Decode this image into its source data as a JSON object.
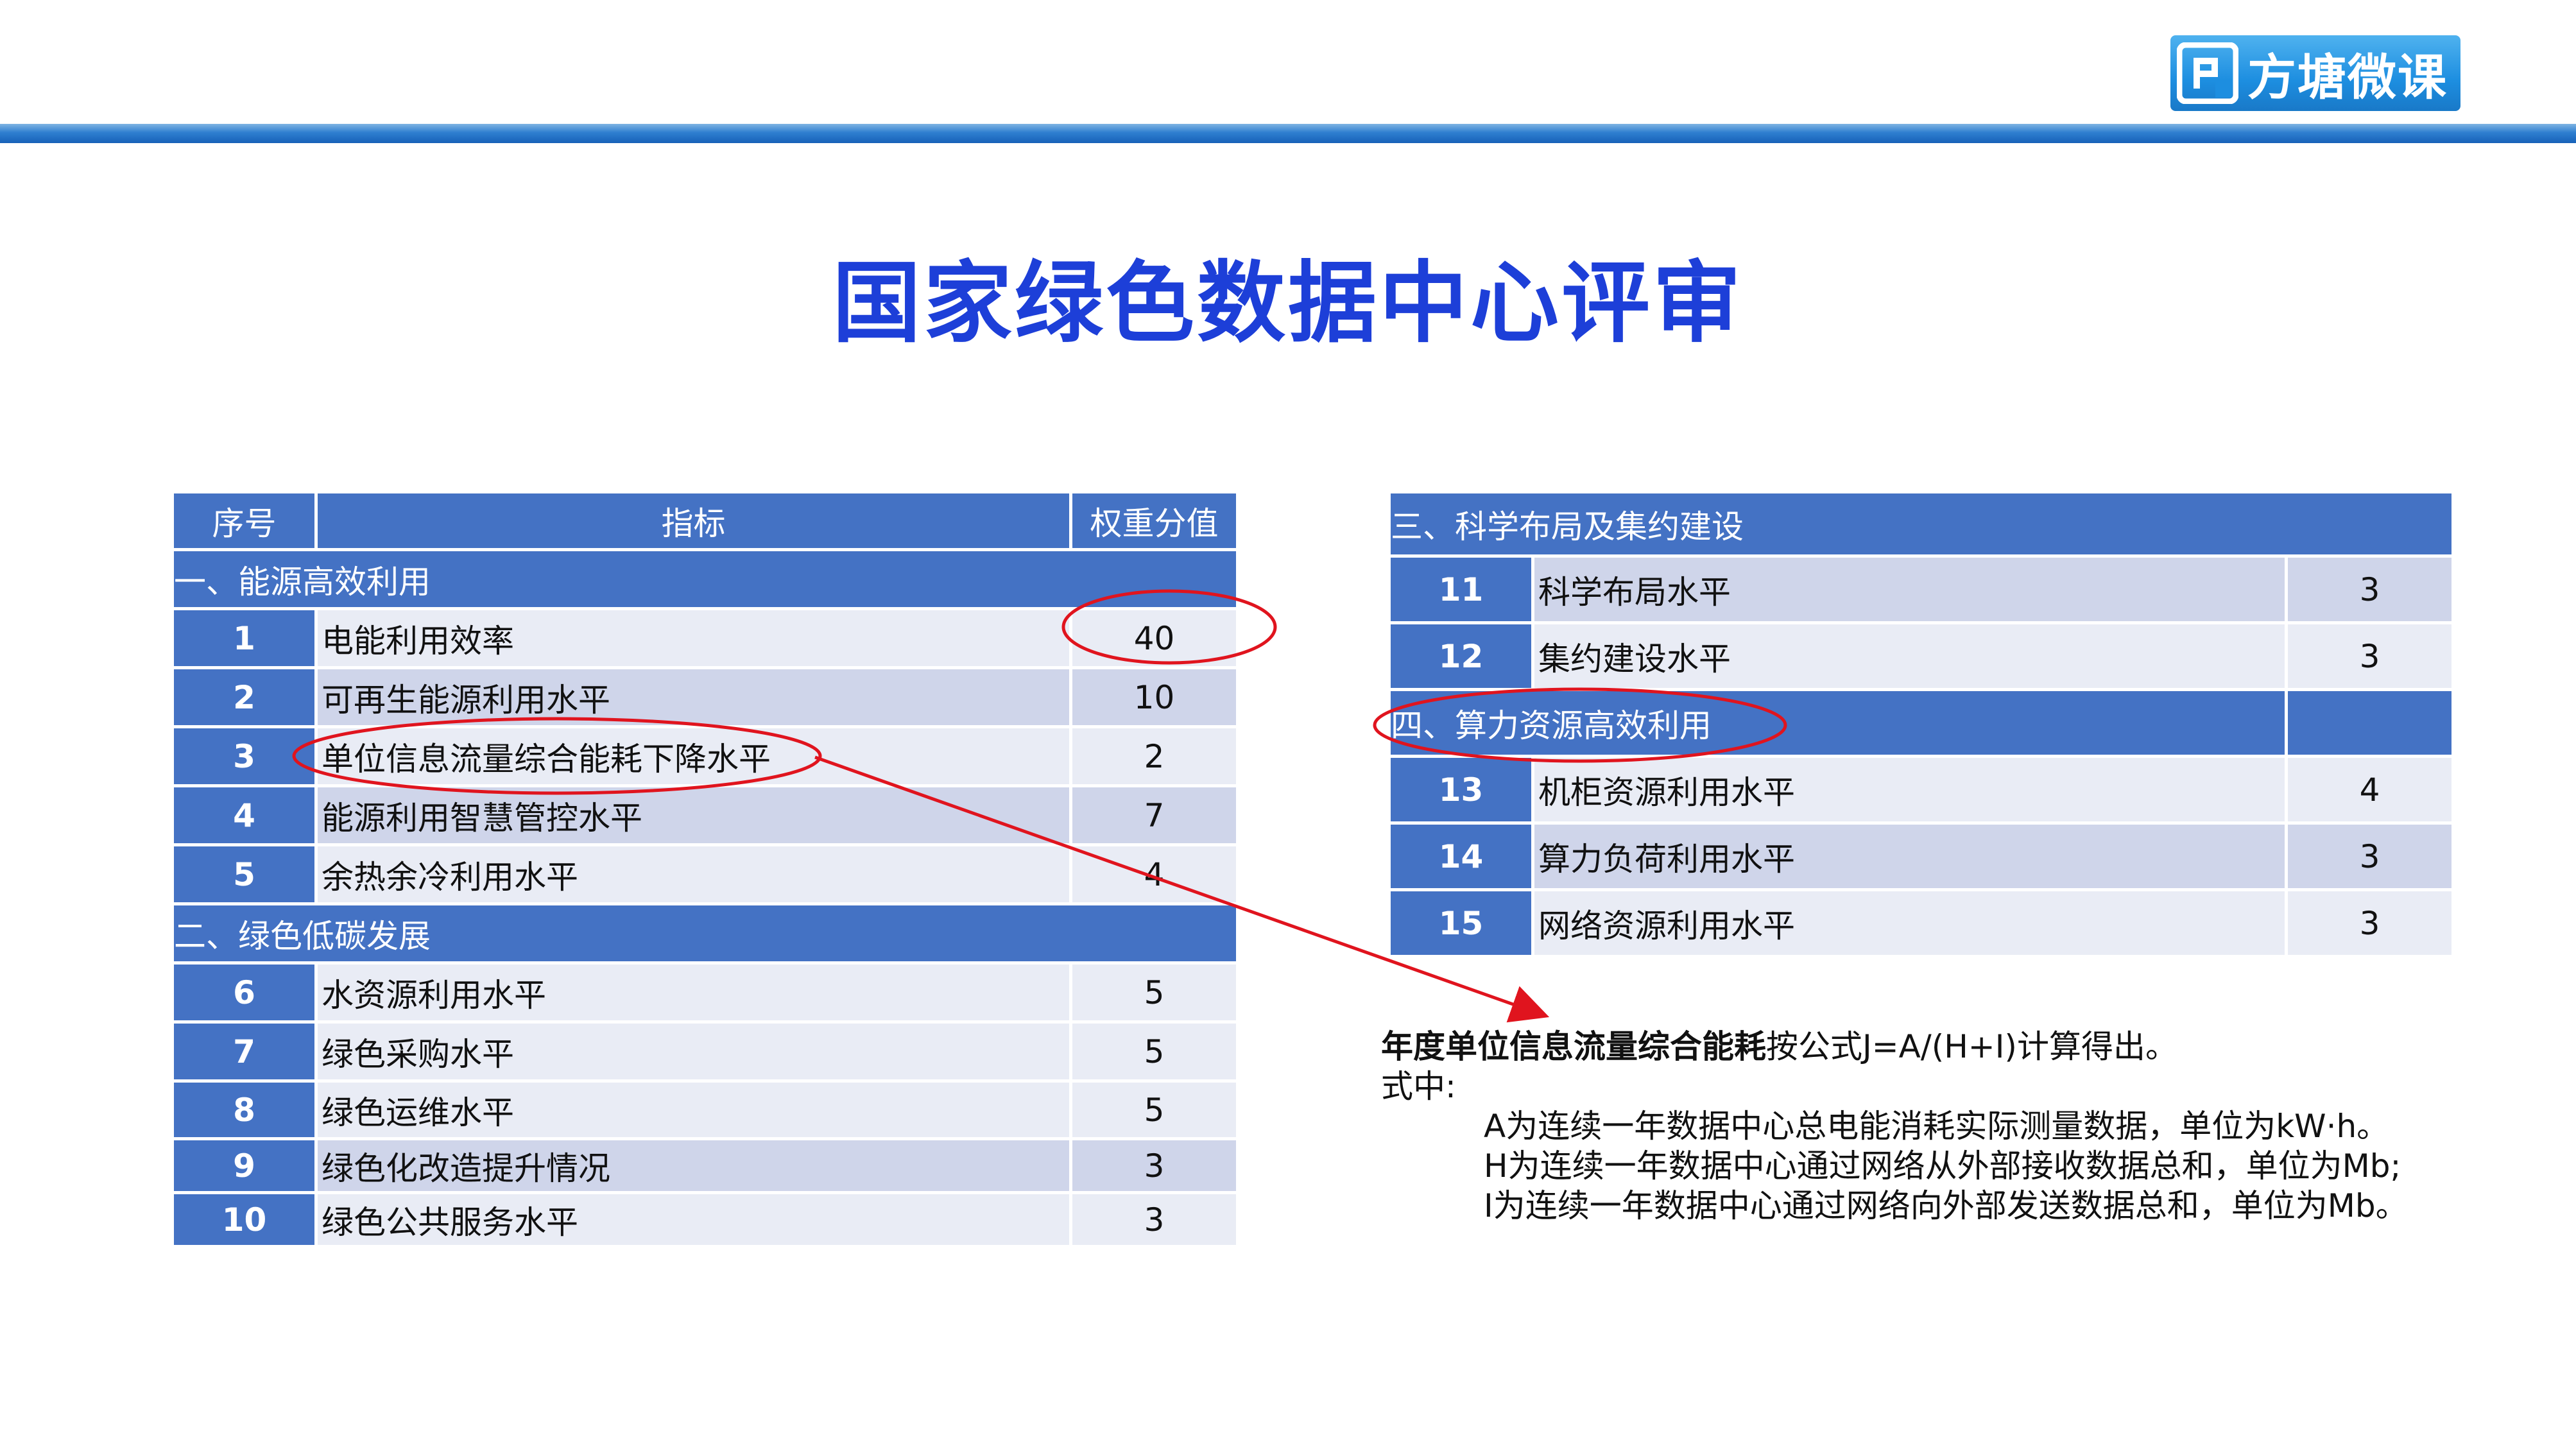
{
  "logo": {
    "text": "方塘微课"
  },
  "title": "国家绿色数据中心评审",
  "left_table": {
    "headers": {
      "no": "序号",
      "indicator": "指标",
      "weight": "权重分值"
    },
    "sections": [
      {
        "title": "一、能源高效利用",
        "rows": [
          {
            "no": "1",
            "indicator": "电能利用效率",
            "weight": "40"
          },
          {
            "no": "2",
            "indicator": "可再生能源利用水平",
            "weight": "10"
          },
          {
            "no": "3",
            "indicator": "单位信息流量综合能耗下降水平",
            "weight": "2"
          },
          {
            "no": "4",
            "indicator": "能源利用智慧管控水平",
            "weight": "7"
          },
          {
            "no": "5",
            "indicator": "余热余冷利用水平",
            "weight": "4"
          }
        ]
      },
      {
        "title": "二、绿色低碳发展",
        "rows": [
          {
            "no": "6",
            "indicator": "水资源利用水平",
            "weight": "5"
          },
          {
            "no": "7",
            "indicator": "绿色采购水平",
            "weight": "5"
          },
          {
            "no": "8",
            "indicator": "绿色运维水平",
            "weight": "5"
          },
          {
            "no": "9",
            "indicator": "绿色化改造提升情况",
            "weight": "3"
          },
          {
            "no": "10",
            "indicator": "绿色公共服务水平",
            "weight": "3"
          }
        ]
      }
    ]
  },
  "right_table": {
    "sections": [
      {
        "title": "三、科学布局及集约建设",
        "rows": [
          {
            "no": "11",
            "indicator": "科学布局水平",
            "weight": "3"
          },
          {
            "no": "12",
            "indicator": "集约建设水平",
            "weight": "3"
          }
        ]
      },
      {
        "title": "四、算力资源高效利用",
        "rows": [
          {
            "no": "13",
            "indicator": "机柜资源利用水平",
            "weight": "4"
          },
          {
            "no": "14",
            "indicator": "算力负荷利用水平",
            "weight": "3"
          },
          {
            "no": "15",
            "indicator": "网络资源利用水平",
            "weight": "3"
          }
        ]
      }
    ]
  },
  "note": {
    "bold": "年度单位信息流量综合能耗",
    "formula": "按公式J=A/(H+I)计算得出。",
    "where": "式中:",
    "lines": [
      "A为连续一年数据中心总电能消耗实际测量数据，单位为kW·h。",
      "H为连续一年数据中心通过网络从外部接收数据总和，单位为Mb;",
      "I为连续一年数据中心通过网络向外部发送数据总和，单位为Mb。"
    ]
  },
  "colors": {
    "header": "#4472c4",
    "title": "#1d3fd8",
    "annotation": "#e0141e"
  }
}
